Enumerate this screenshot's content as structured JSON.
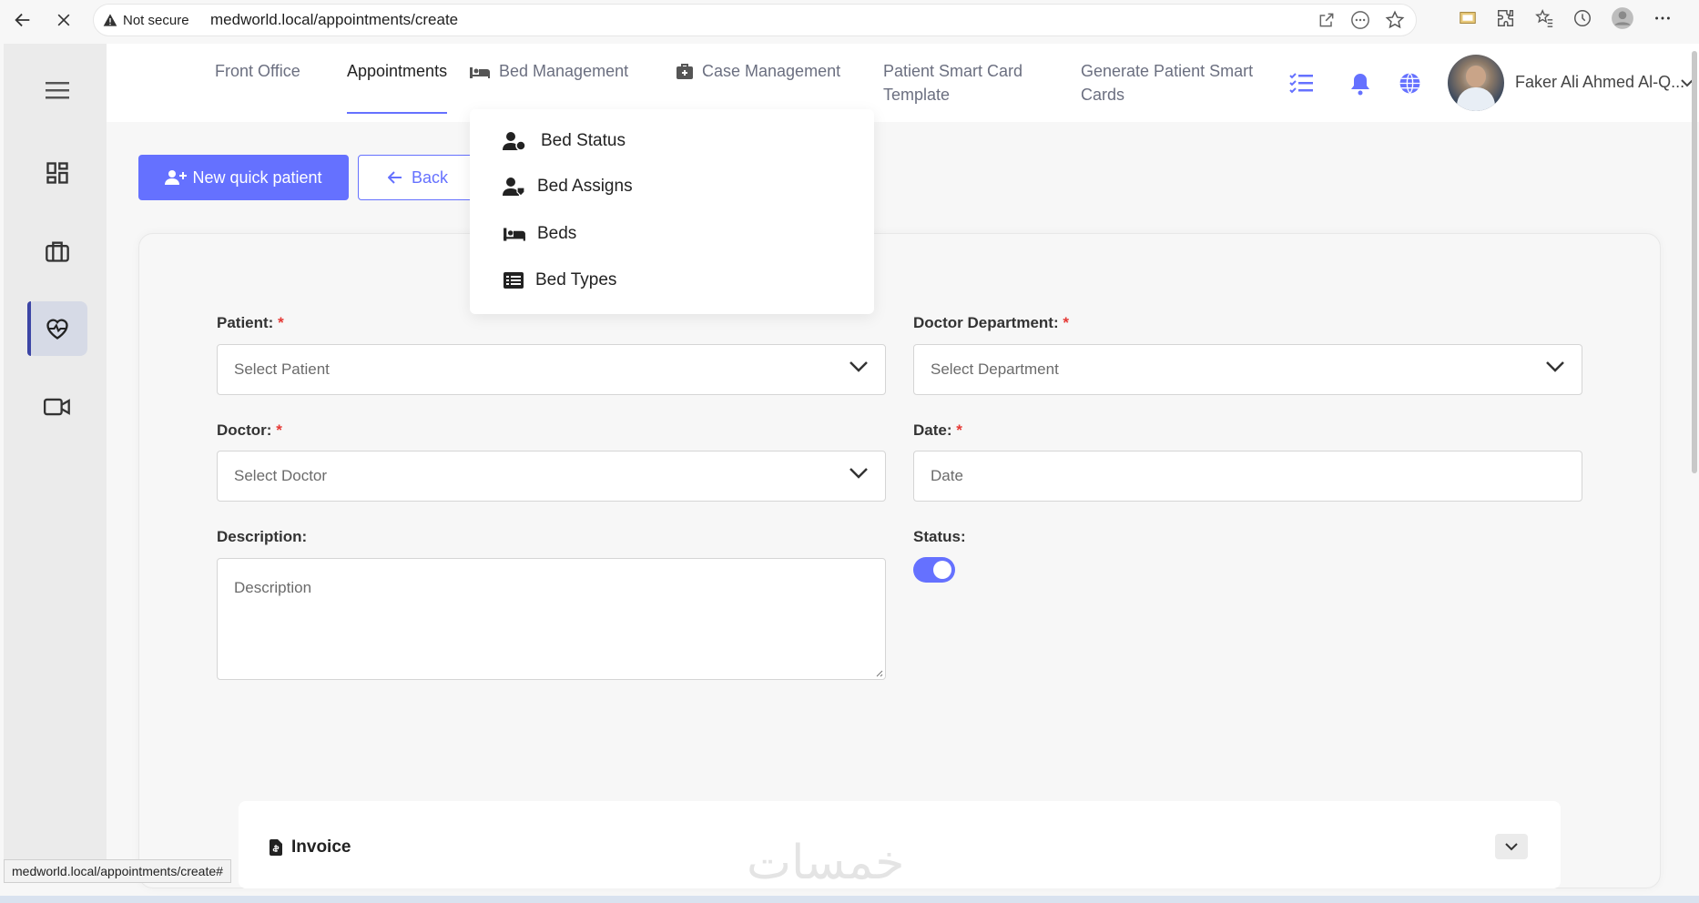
{
  "browser": {
    "security_label": "Not secure",
    "url": "medworld.local/appointments/create",
    "status_url": "medworld.local/appointments/create#"
  },
  "header": {
    "nav": [
      {
        "label": "Front Office"
      },
      {
        "label": "Appointments"
      },
      {
        "label": "Bed Management"
      },
      {
        "label": "Case Management"
      },
      {
        "label": "Patient Smart Card Template"
      },
      {
        "label": "Generate Patient Smart Cards"
      }
    ],
    "user_name": "Faker Ali Ahmed Al-Q..."
  },
  "dropdown": {
    "items": [
      {
        "label": "Bed Status",
        "icon": "user-bed-icon"
      },
      {
        "label": "Bed Assigns",
        "icon": "user-assign-icon"
      },
      {
        "label": "Beds",
        "icon": "bed-icon"
      },
      {
        "label": "Bed Types",
        "icon": "list-icon"
      }
    ]
  },
  "toolbar": {
    "new_quick_patient": "New quick patient",
    "back": "Back"
  },
  "form": {
    "patient": {
      "label": "Patient:",
      "placeholder": "Select Patient"
    },
    "doctor_department": {
      "label": "Doctor Department:",
      "placeholder": "Select Department"
    },
    "doctor": {
      "label": "Doctor:",
      "placeholder": "Select Doctor"
    },
    "date": {
      "label": "Date:",
      "placeholder": "Date"
    },
    "description": {
      "label": "Description:",
      "placeholder": "Description"
    },
    "status": {
      "label": "Status:",
      "enabled": true
    },
    "required_mark": "*"
  },
  "invoice": {
    "title": "Invoice"
  },
  "watermark": "خمسات",
  "colors": {
    "accent": "#6571ff",
    "required": "#e53935"
  }
}
